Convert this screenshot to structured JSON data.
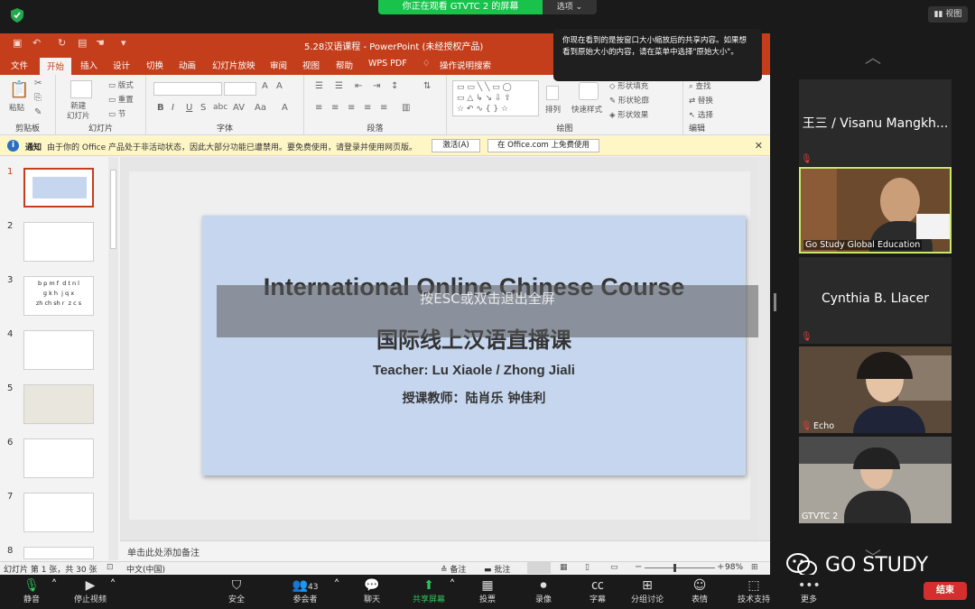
{
  "zoom_top": {
    "share_banner": "你正在观看 GTVTC 2 的屏幕",
    "options_label": "选项",
    "view_label": "视图"
  },
  "ppt": {
    "window_title": "5.28汉语课程  -  PowerPoint (未经授权产品)",
    "tabs": [
      "文件",
      "开始",
      "插入",
      "设计",
      "切换",
      "动画",
      "幻灯片放映",
      "审阅",
      "视图",
      "帮助",
      "WPS PDF",
      "操作说明搜索"
    ],
    "active_tab": "开始",
    "ribbon_groups": {
      "clipboard": "剪贴板",
      "slides": "幻灯片",
      "font": "字体",
      "paragraph": "段落",
      "drawing": "绘图",
      "editing": "编辑"
    },
    "ribbon_items": {
      "paste": "粘贴",
      "new_slide": "新建\n幻灯片",
      "layout": "版式",
      "reset": "重置",
      "section": "节",
      "arrange": "排列",
      "quick_styles": "快速样式",
      "shape_fill": "形状填充",
      "shape_outline": "形状轮廓",
      "shape_effects": "形状效果",
      "find": "查找",
      "replace": "替换",
      "select": "选择"
    },
    "notice": {
      "label": "通知",
      "text": "由于你的 Office 产品处于非活动状态，因此大部分功能已遭禁用。要免费使用，请登录并使用网页版。",
      "activate_btn": "激活(A)",
      "free_btn": "在 Office.com 上免费使用"
    },
    "thumbnails": [
      "1",
      "2",
      "3",
      "4",
      "5",
      "6",
      "7",
      "8"
    ],
    "thumb3_text": "b p m f  d t n l\ng k h  j q x\nzh ch sh r  z c s",
    "slide": {
      "title_en": "International Online Chinese Course",
      "title_cn": "国际线上汉语直播课",
      "teacher_en": "Teacher: Lu Xiaole / Zhong Jiali",
      "teacher_cn": "授课教师：陆肖乐  钟佳利",
      "esc_hint": "按ESC或双击退出全屏"
    },
    "notes_placeholder": "单击此处添加备注",
    "status": {
      "slide_info": "幻灯片 第 1 张，共 30 张",
      "language": "中文(中国)",
      "notes": "备注",
      "comments": "批注",
      "zoom": "98%"
    },
    "tooltip": "你现在看到的是按窗口大小缩放后的共享内容。如果想看到原始大小的内容，请在菜单中选择\"原始大小\"。"
  },
  "participants": [
    {
      "name": "王三 / Visanu Mangkh...",
      "video": false,
      "muted": true
    },
    {
      "name": "Go Study Global Education",
      "video": true,
      "muted": false,
      "active": true
    },
    {
      "name": "Cynthia B. Llacer",
      "video": false,
      "muted": true
    },
    {
      "name": "Echo",
      "video": true,
      "muted": true
    },
    {
      "name": "GTVTC 2",
      "video": true,
      "muted": false
    }
  ],
  "bottom_bar": {
    "mute": "静音",
    "stop_video": "停止视频",
    "security": "安全",
    "participants": "参会者",
    "participants_count": "43",
    "chat": "聊天",
    "share_screen": "共享屏幕",
    "poll": "投票",
    "record": "录像",
    "captions": "字幕",
    "breakout": "分组讨论",
    "reactions": "表情",
    "support": "技术支持",
    "more": "更多",
    "end": "结束"
  },
  "watermark": "GO STUDY",
  "colors": {
    "ppt_red": "#c43e1c",
    "zoom_green": "#19c24b",
    "end_red": "#d42e2e",
    "active_speaker": "#c9e86b"
  }
}
